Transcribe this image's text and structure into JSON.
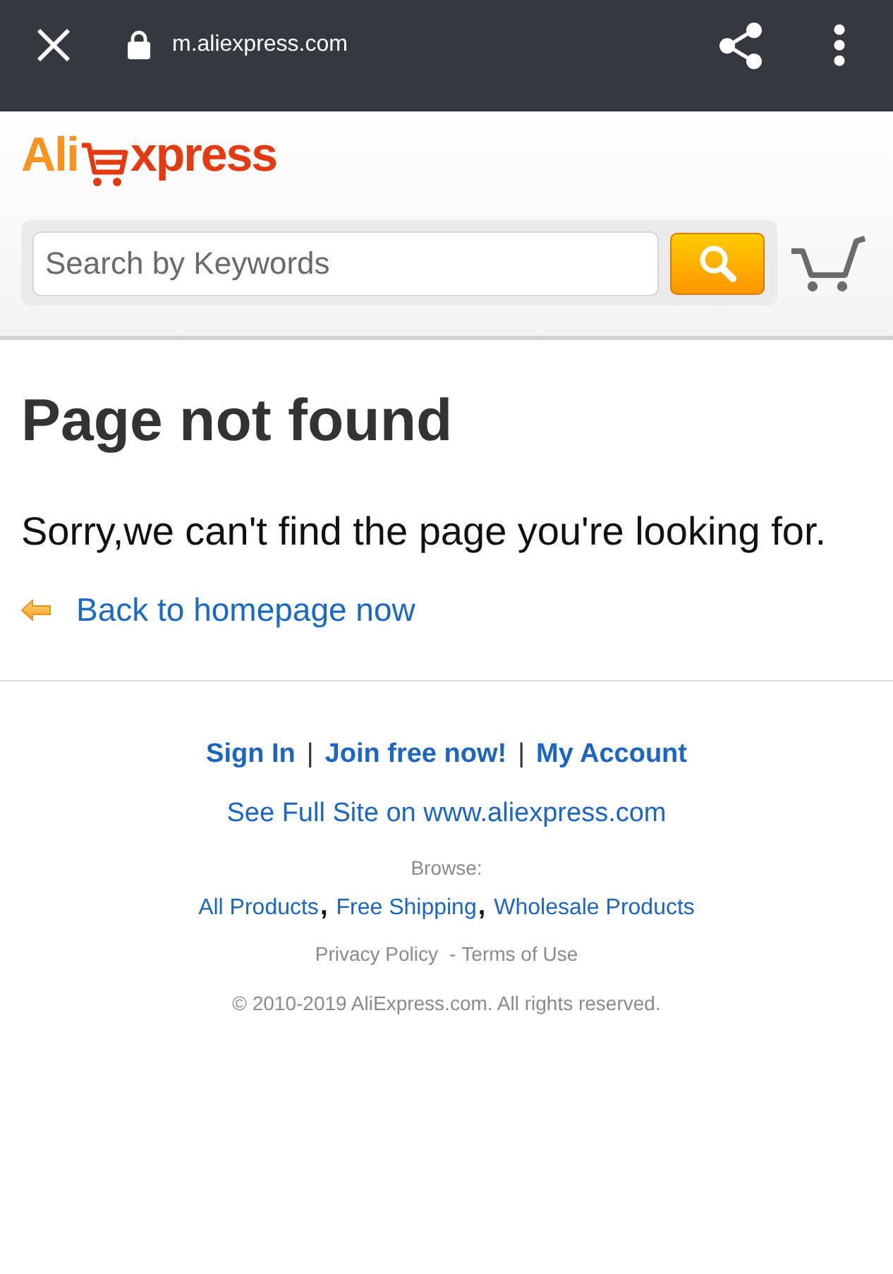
{
  "browser_bar": {
    "url": "m.aliexpress.com"
  },
  "logo": {
    "text_left": "Ali",
    "text_right": "xpress"
  },
  "search": {
    "placeholder": "Search by Keywords"
  },
  "error": {
    "title": "Page not found",
    "message": "Sorry,we can't find the page you're looking for.",
    "back_link": "Back to homepage now"
  },
  "footer": {
    "account_links": [
      {
        "kind": "link",
        "text": "Sign In"
      },
      {
        "kind": "separator",
        "text": "|"
      },
      {
        "kind": "link",
        "text": "Join free now!"
      },
      {
        "kind": "separator",
        "text": "|"
      },
      {
        "kind": "link",
        "text": "My Account"
      }
    ],
    "full_site_link": "See Full Site on www.aliexpress.com",
    "browse_label": "Browse:",
    "browse_links": [
      {
        "kind": "link",
        "text": "All Products"
      },
      {
        "kind": "separator",
        "text": ","
      },
      {
        "kind": "link",
        "text": "Free Shipping"
      },
      {
        "kind": "separator",
        "text": ","
      },
      {
        "kind": "link",
        "text": "Wholesale Products"
      }
    ],
    "legal_links": [
      {
        "kind": "link",
        "text": "Privacy Policy"
      },
      {
        "kind": "separator",
        "text": "-"
      },
      {
        "kind": "link",
        "text": "Terms of Use"
      }
    ],
    "copyright": "© 2010-2019 AliExpress.com. All rights reserved."
  }
}
